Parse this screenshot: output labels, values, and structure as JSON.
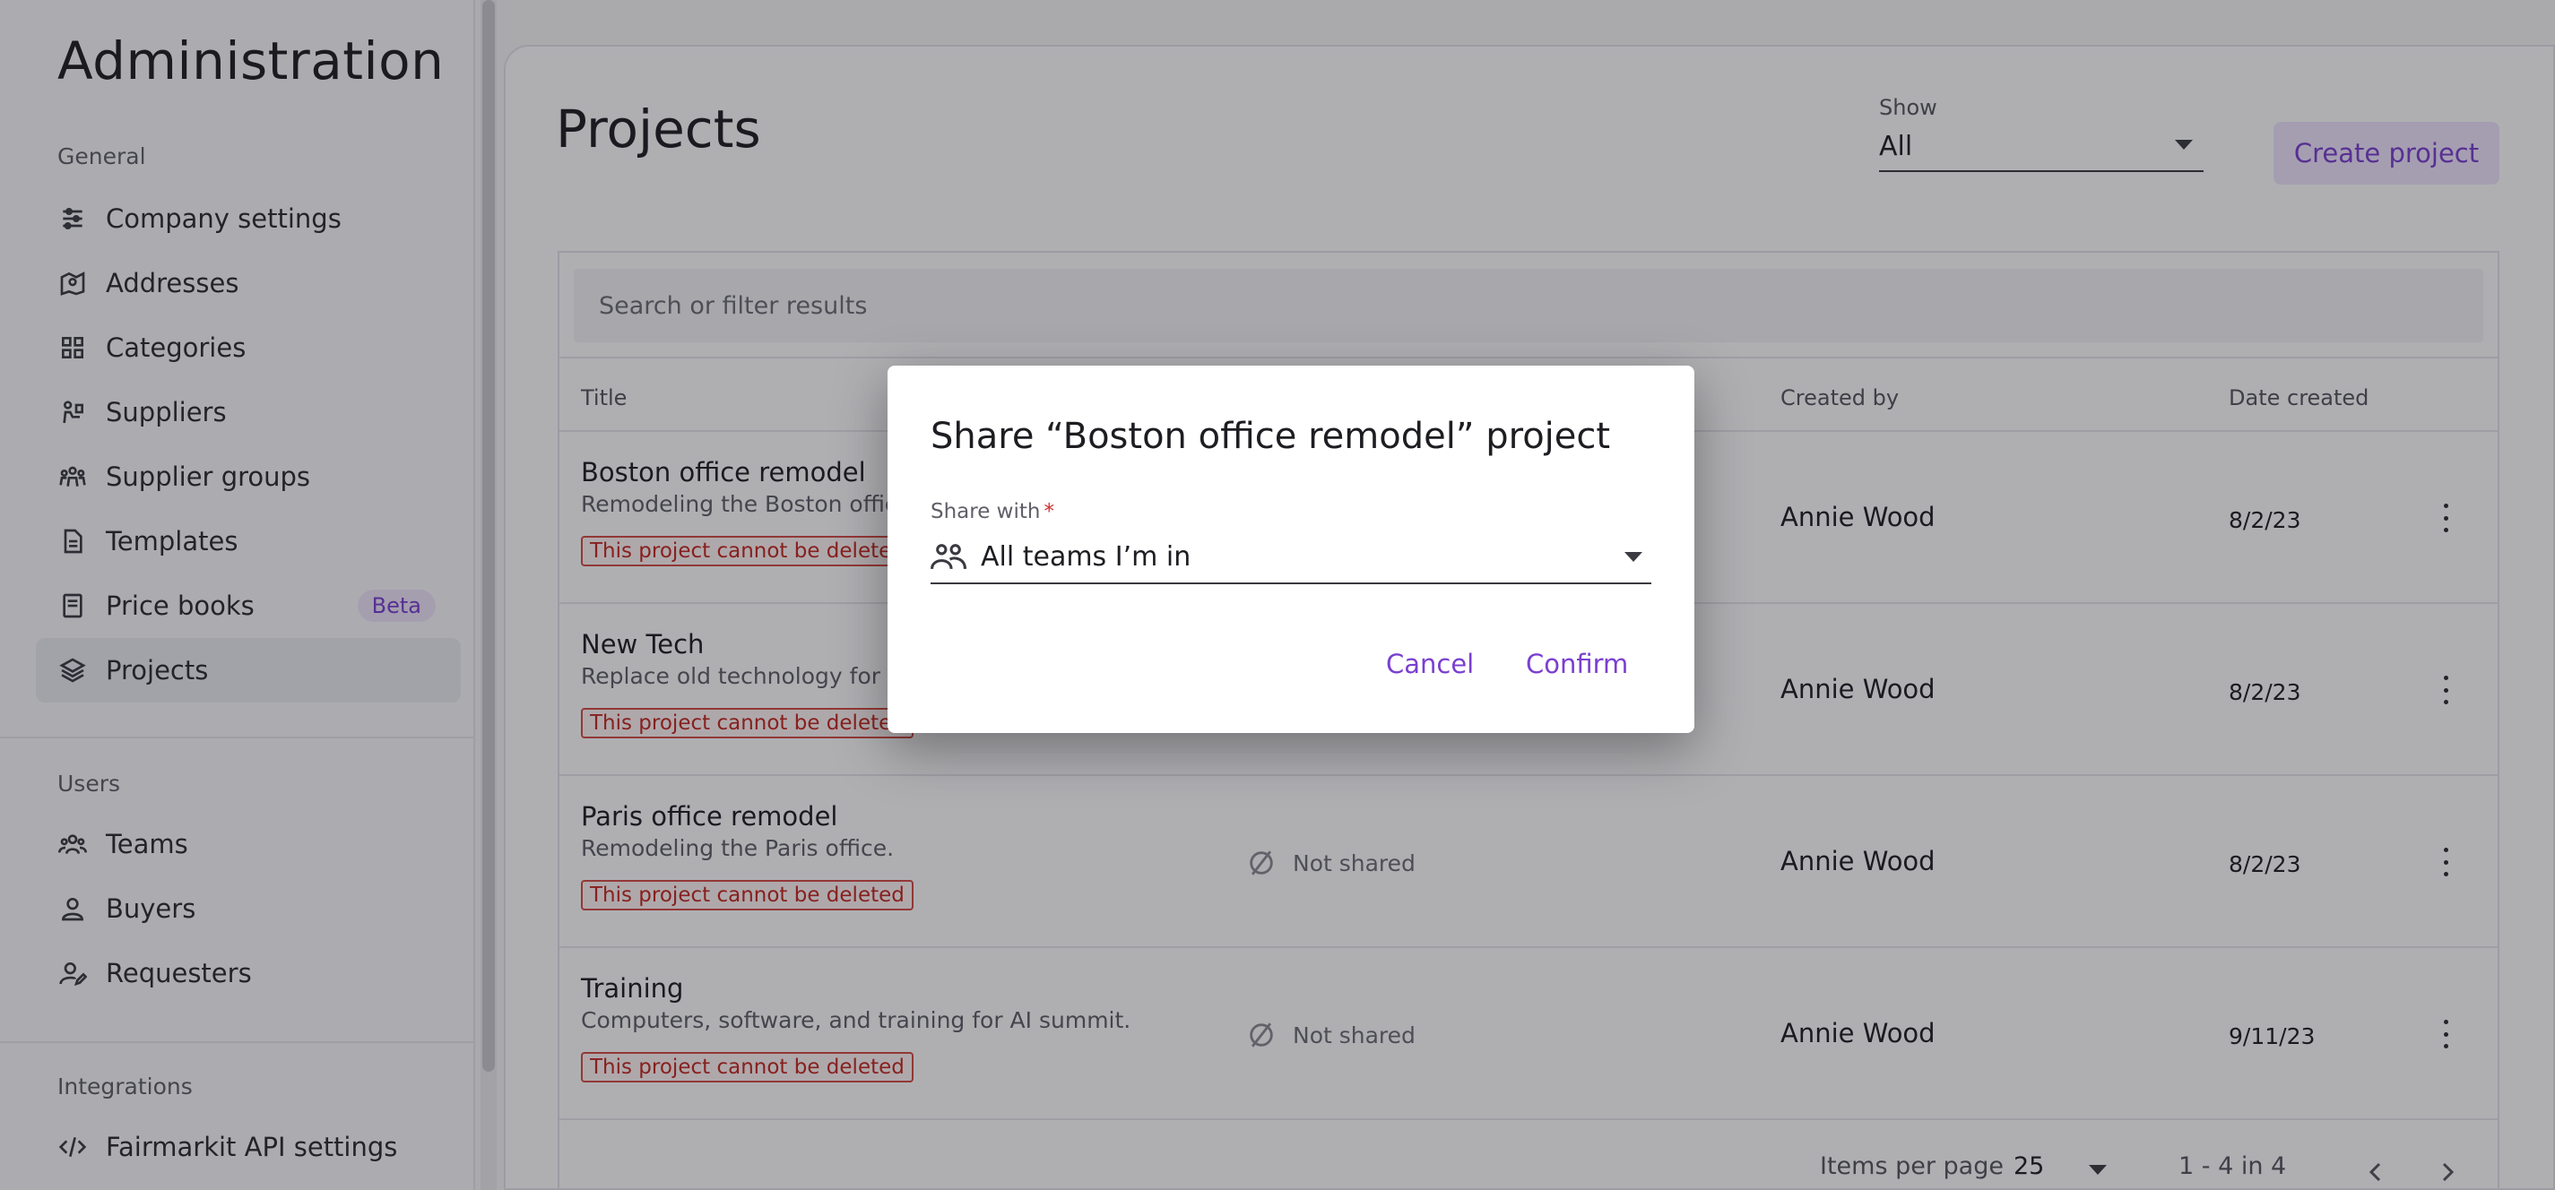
{
  "sidebar": {
    "title": "Administration",
    "sections": {
      "general": "General",
      "users": "Users",
      "integrations": "Integrations"
    },
    "items": [
      {
        "label": "Company settings",
        "icon": "sliders-icon"
      },
      {
        "label": "Addresses",
        "icon": "map-pin-icon"
      },
      {
        "label": "Categories",
        "icon": "grid-icon"
      },
      {
        "label": "Suppliers",
        "icon": "supplier-icon"
      },
      {
        "label": "Supplier groups",
        "icon": "group-icon"
      },
      {
        "label": "Templates",
        "icon": "document-icon"
      },
      {
        "label": "Price books",
        "icon": "book-icon",
        "badge": "Beta"
      },
      {
        "label": "Projects",
        "icon": "layers-icon",
        "active": true
      },
      {
        "label": "Teams",
        "icon": "team-icon"
      },
      {
        "label": "Buyers",
        "icon": "user-icon"
      },
      {
        "label": "Requesters",
        "icon": "user-edit-icon"
      },
      {
        "label": "Fairmarkit API settings",
        "icon": "code-icon"
      }
    ]
  },
  "main": {
    "title": "Projects",
    "show_label": "Show",
    "show_value": "All",
    "create_button": "Create project",
    "search_placeholder": "Search or filter results",
    "columns": {
      "title": "Title",
      "created_by": "Created by",
      "date_created": "Date created"
    },
    "rows": [
      {
        "title": "Boston office remodel",
        "desc": "Remodeling the Boston office.",
        "warning": "This project cannot be deleted",
        "created_by": "Annie Wood",
        "date": "8/2/23"
      },
      {
        "title": "New Tech",
        "desc": "Replace old technology for dep",
        "warning": "This project cannot be deleted",
        "created_by": "Annie Wood",
        "date": "8/2/23"
      },
      {
        "title": "Paris office remodel",
        "desc": "Remodeling the Paris office.",
        "warning": "This project cannot be deleted",
        "sharing": "Not shared",
        "created_by": "Annie Wood",
        "date": "8/2/23"
      },
      {
        "title": "Training",
        "desc": "Computers, software, and training for AI summit.",
        "warning": "This project cannot be deleted",
        "sharing": "Not shared",
        "created_by": "Annie Wood",
        "date": "9/11/23"
      }
    ],
    "pagination": {
      "items_per_page_label": "Items per page",
      "items_per_page": "25",
      "range": "1 - 4 in 4"
    }
  },
  "dialog": {
    "title": "Share “Boston office remodel” project",
    "share_with_label": "Share with",
    "required_mark": "*",
    "share_with_value": "All teams I’m in",
    "cancel": "Cancel",
    "confirm": "Confirm"
  },
  "colors": {
    "accent": "#7a3fd0",
    "warning": "#c2271f",
    "overlay": "#14141c"
  }
}
